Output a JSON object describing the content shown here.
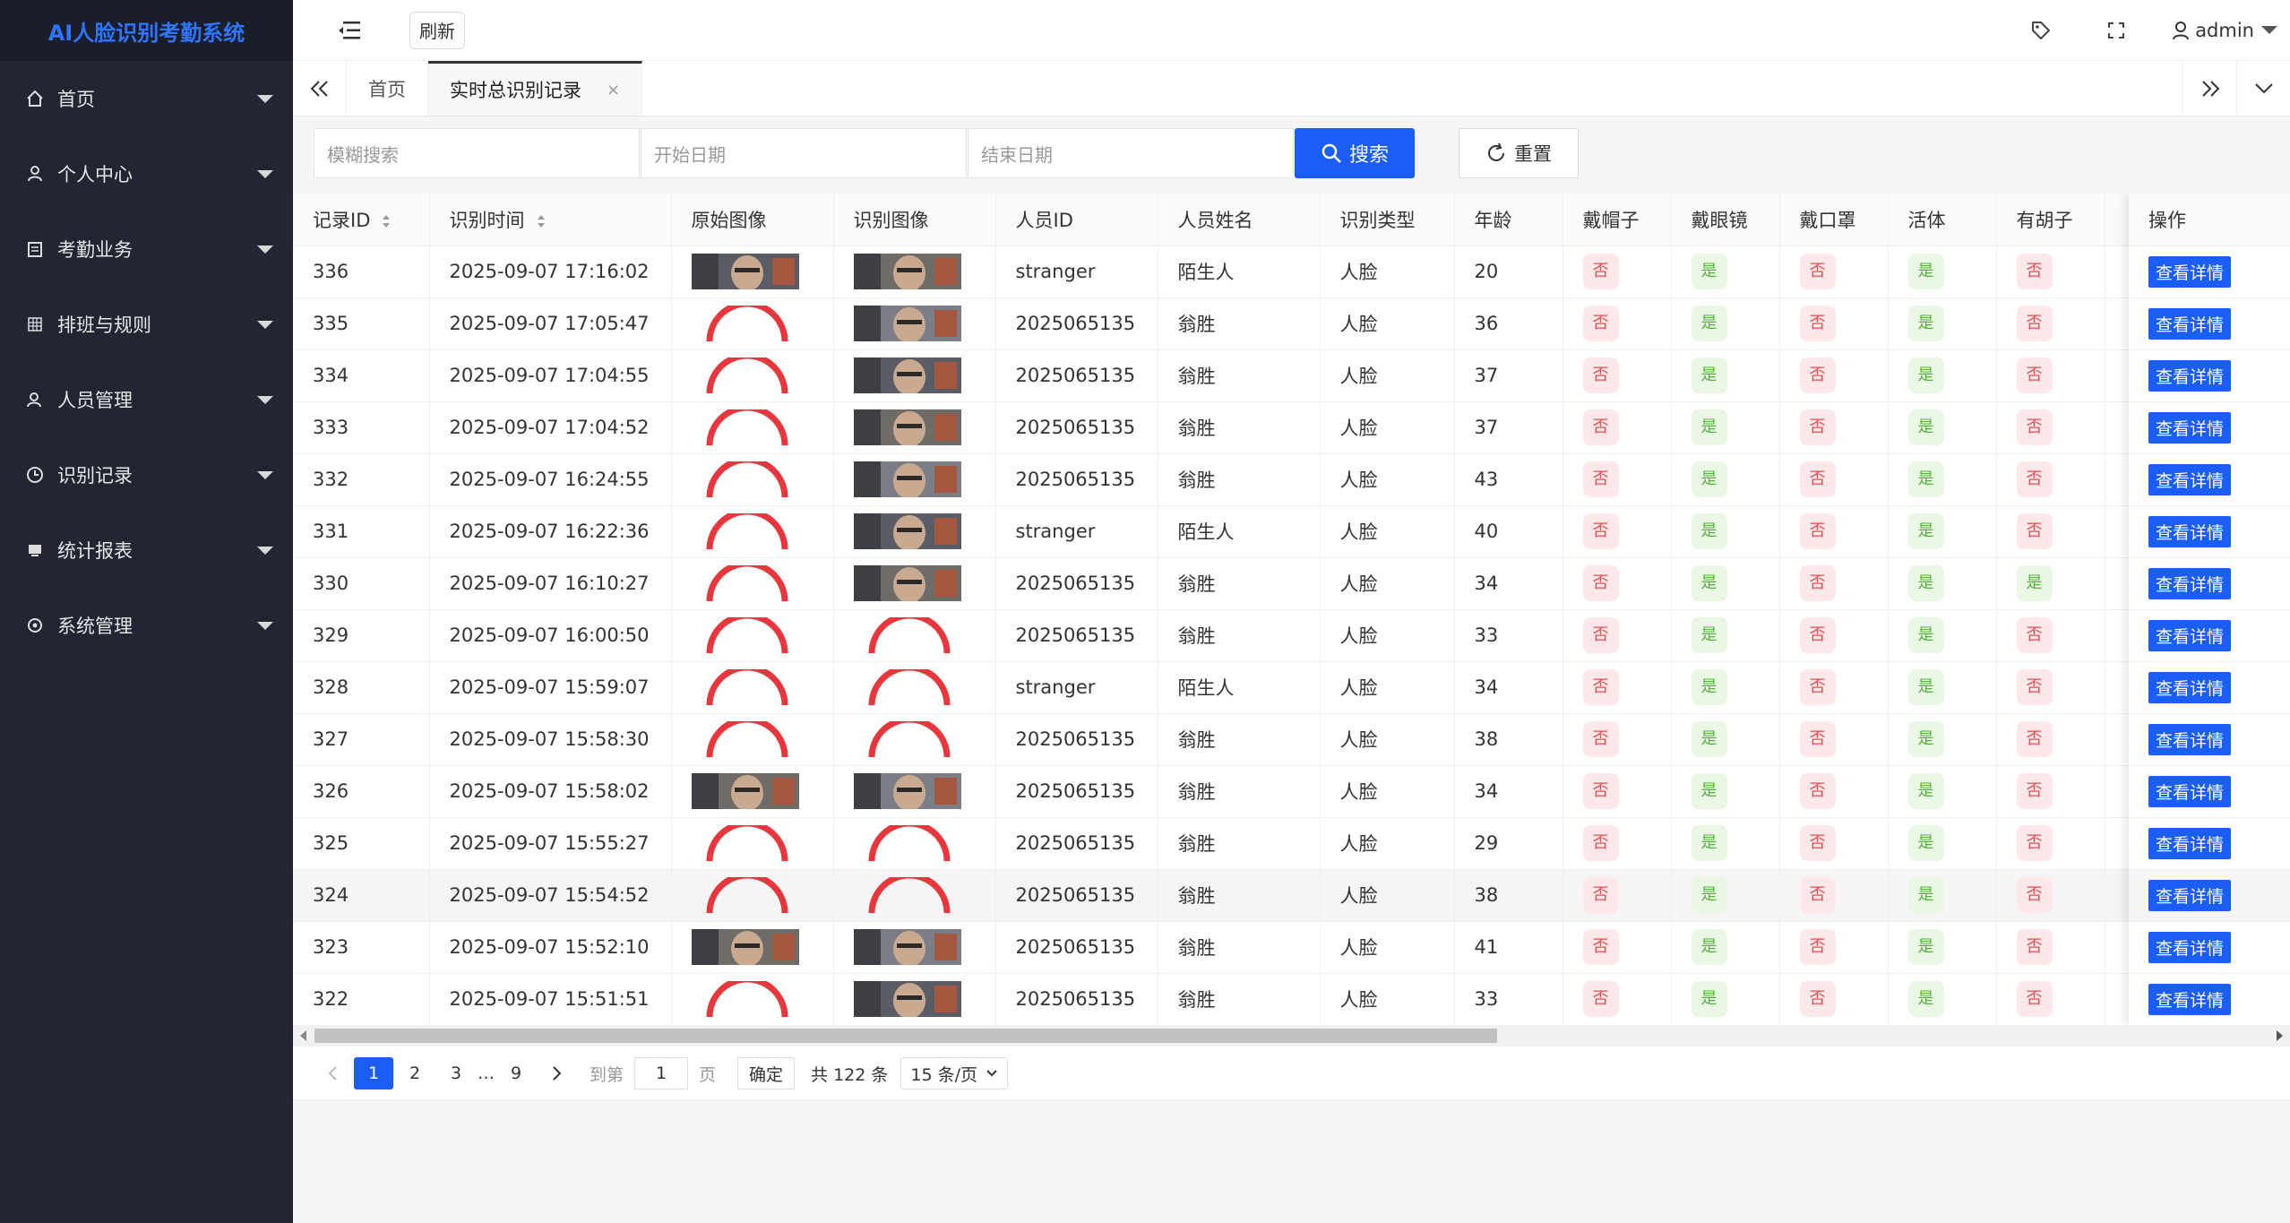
{
  "app": {
    "title": "AI人脸识别考勤系统"
  },
  "sidebar": {
    "items": [
      {
        "label": "首页",
        "icon": "home-icon"
      },
      {
        "label": "个人中心",
        "icon": "user-icon"
      },
      {
        "label": "考勤业务",
        "icon": "calendar-icon"
      },
      {
        "label": "排班与规则",
        "icon": "grid-icon"
      },
      {
        "label": "人员管理",
        "icon": "users-icon"
      },
      {
        "label": "识别记录",
        "icon": "clock-icon"
      },
      {
        "label": "统计报表",
        "icon": "monitor-icon"
      },
      {
        "label": "系统管理",
        "icon": "settings-icon"
      }
    ]
  },
  "header": {
    "refresh_label": "刷新",
    "username": "admin"
  },
  "tabs": [
    {
      "label": "首页"
    },
    {
      "label": "实时总识别记录",
      "active": true
    }
  ],
  "search": {
    "keyword_placeholder": "模糊搜索",
    "start_placeholder": "开始日期",
    "end_placeholder": "结束日期",
    "search_label": "搜索",
    "reset_label": "重置"
  },
  "table": {
    "columns": [
      "记录ID",
      "识别时间",
      "原始图像",
      "识别图像",
      "人员ID",
      "人员姓名",
      "识别类型",
      "年龄",
      "戴帽子",
      "戴眼镜",
      "戴口罩",
      "活体",
      "有胡子"
    ],
    "action_header": "操作",
    "action_label": "查看详情",
    "yes": "是",
    "no": "否",
    "rows": [
      {
        "id": "336",
        "time": "2025-09-07 17:16:02",
        "orig": "img",
        "recog": "img",
        "pid": "stranger",
        "name": "陌生人",
        "type": "人脸",
        "age": "20",
        "hat": false,
        "glasses": true,
        "mask": false,
        "live": true,
        "beard": false
      },
      {
        "id": "335",
        "time": "2025-09-07 17:05:47",
        "orig": "load",
        "recog": "img",
        "pid": "2025065135",
        "name": "翁胜",
        "type": "人脸",
        "age": "36",
        "hat": false,
        "glasses": true,
        "mask": false,
        "live": true,
        "beard": false
      },
      {
        "id": "334",
        "time": "2025-09-07 17:04:55",
        "orig": "load",
        "recog": "img",
        "pid": "2025065135",
        "name": "翁胜",
        "type": "人脸",
        "age": "37",
        "hat": false,
        "glasses": true,
        "mask": false,
        "live": true,
        "beard": false
      },
      {
        "id": "333",
        "time": "2025-09-07 17:04:52",
        "orig": "load",
        "recog": "img",
        "pid": "2025065135",
        "name": "翁胜",
        "type": "人脸",
        "age": "37",
        "hat": false,
        "glasses": true,
        "mask": false,
        "live": true,
        "beard": false
      },
      {
        "id": "332",
        "time": "2025-09-07 16:24:55",
        "orig": "load",
        "recog": "img",
        "pid": "2025065135",
        "name": "翁胜",
        "type": "人脸",
        "age": "43",
        "hat": false,
        "glasses": true,
        "mask": false,
        "live": true,
        "beard": false
      },
      {
        "id": "331",
        "time": "2025-09-07 16:22:36",
        "orig": "load",
        "recog": "img",
        "pid": "stranger",
        "name": "陌生人",
        "type": "人脸",
        "age": "40",
        "hat": false,
        "glasses": true,
        "mask": false,
        "live": true,
        "beard": false
      },
      {
        "id": "330",
        "time": "2025-09-07 16:10:27",
        "orig": "load",
        "recog": "img",
        "pid": "2025065135",
        "name": "翁胜",
        "type": "人脸",
        "age": "34",
        "hat": false,
        "glasses": true,
        "mask": false,
        "live": true,
        "beard": true
      },
      {
        "id": "329",
        "time": "2025-09-07 16:00:50",
        "orig": "load",
        "recog": "load",
        "pid": "2025065135",
        "name": "翁胜",
        "type": "人脸",
        "age": "33",
        "hat": false,
        "glasses": true,
        "mask": false,
        "live": true,
        "beard": false
      },
      {
        "id": "328",
        "time": "2025-09-07 15:59:07",
        "orig": "load",
        "recog": "load",
        "pid": "stranger",
        "name": "陌生人",
        "type": "人脸",
        "age": "34",
        "hat": false,
        "glasses": true,
        "mask": false,
        "live": true,
        "beard": false
      },
      {
        "id": "327",
        "time": "2025-09-07 15:58:30",
        "orig": "load",
        "recog": "load",
        "pid": "2025065135",
        "name": "翁胜",
        "type": "人脸",
        "age": "38",
        "hat": false,
        "glasses": true,
        "mask": false,
        "live": true,
        "beard": false
      },
      {
        "id": "326",
        "time": "2025-09-07 15:58:02",
        "orig": "img",
        "recog": "img",
        "pid": "2025065135",
        "name": "翁胜",
        "type": "人脸",
        "age": "34",
        "hat": false,
        "glasses": true,
        "mask": false,
        "live": true,
        "beard": false
      },
      {
        "id": "325",
        "time": "2025-09-07 15:55:27",
        "orig": "load",
        "recog": "load",
        "pid": "2025065135",
        "name": "翁胜",
        "type": "人脸",
        "age": "29",
        "hat": false,
        "glasses": true,
        "mask": false,
        "live": true,
        "beard": false
      },
      {
        "id": "324",
        "time": "2025-09-07 15:54:52",
        "orig": "load",
        "recog": "load",
        "pid": "2025065135",
        "name": "翁胜",
        "type": "人脸",
        "age": "38",
        "hat": false,
        "glasses": true,
        "mask": false,
        "live": true,
        "beard": false,
        "highlight": true
      },
      {
        "id": "323",
        "time": "2025-09-07 15:52:10",
        "orig": "img",
        "recog": "img",
        "pid": "2025065135",
        "name": "翁胜",
        "type": "人脸",
        "age": "41",
        "hat": false,
        "glasses": true,
        "mask": false,
        "live": true,
        "beard": false
      },
      {
        "id": "322",
        "time": "2025-09-07 15:51:51",
        "orig": "load",
        "recog": "img",
        "pid": "2025065135",
        "name": "翁胜",
        "type": "人脸",
        "age": "33",
        "hat": false,
        "glasses": true,
        "mask": false,
        "live": true,
        "beard": false
      }
    ]
  },
  "pagination": {
    "pages": [
      "1",
      "2",
      "3",
      "…",
      "9"
    ],
    "current": "1",
    "goto_label": "到第",
    "goto_value": "1",
    "page_unit": "页",
    "confirm_label": "确定",
    "total_text": "共 122 条",
    "page_size": "15 条/页"
  },
  "colors": {
    "primary": "#1b5ef5",
    "sidebar": "#212632",
    "yes_text": "#57b33d",
    "no_text": "#e84a51",
    "spinner": "#e8373c"
  }
}
